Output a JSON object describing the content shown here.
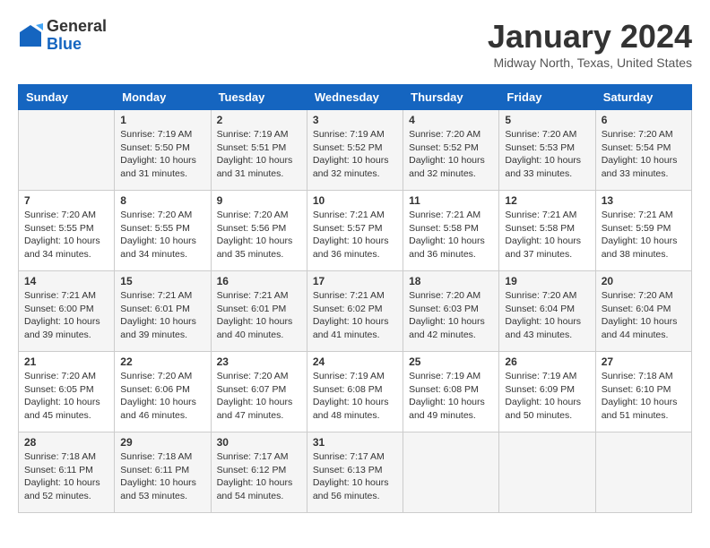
{
  "header": {
    "logo": {
      "line1": "General",
      "line2": "Blue"
    },
    "title": "January 2024",
    "location": "Midway North, Texas, United States"
  },
  "days_of_week": [
    "Sunday",
    "Monday",
    "Tuesday",
    "Wednesday",
    "Thursday",
    "Friday",
    "Saturday"
  ],
  "weeks": [
    [
      {
        "day": "",
        "info": ""
      },
      {
        "day": "1",
        "info": "Sunrise: 7:19 AM\nSunset: 5:50 PM\nDaylight: 10 hours\nand 31 minutes."
      },
      {
        "day": "2",
        "info": "Sunrise: 7:19 AM\nSunset: 5:51 PM\nDaylight: 10 hours\nand 31 minutes."
      },
      {
        "day": "3",
        "info": "Sunrise: 7:19 AM\nSunset: 5:52 PM\nDaylight: 10 hours\nand 32 minutes."
      },
      {
        "day": "4",
        "info": "Sunrise: 7:20 AM\nSunset: 5:52 PM\nDaylight: 10 hours\nand 32 minutes."
      },
      {
        "day": "5",
        "info": "Sunrise: 7:20 AM\nSunset: 5:53 PM\nDaylight: 10 hours\nand 33 minutes."
      },
      {
        "day": "6",
        "info": "Sunrise: 7:20 AM\nSunset: 5:54 PM\nDaylight: 10 hours\nand 33 minutes."
      }
    ],
    [
      {
        "day": "7",
        "info": "Sunrise: 7:20 AM\nSunset: 5:55 PM\nDaylight: 10 hours\nand 34 minutes."
      },
      {
        "day": "8",
        "info": "Sunrise: 7:20 AM\nSunset: 5:55 PM\nDaylight: 10 hours\nand 34 minutes."
      },
      {
        "day": "9",
        "info": "Sunrise: 7:20 AM\nSunset: 5:56 PM\nDaylight: 10 hours\nand 35 minutes."
      },
      {
        "day": "10",
        "info": "Sunrise: 7:21 AM\nSunset: 5:57 PM\nDaylight: 10 hours\nand 36 minutes."
      },
      {
        "day": "11",
        "info": "Sunrise: 7:21 AM\nSunset: 5:58 PM\nDaylight: 10 hours\nand 36 minutes."
      },
      {
        "day": "12",
        "info": "Sunrise: 7:21 AM\nSunset: 5:58 PM\nDaylight: 10 hours\nand 37 minutes."
      },
      {
        "day": "13",
        "info": "Sunrise: 7:21 AM\nSunset: 5:59 PM\nDaylight: 10 hours\nand 38 minutes."
      }
    ],
    [
      {
        "day": "14",
        "info": "Sunrise: 7:21 AM\nSunset: 6:00 PM\nDaylight: 10 hours\nand 39 minutes."
      },
      {
        "day": "15",
        "info": "Sunrise: 7:21 AM\nSunset: 6:01 PM\nDaylight: 10 hours\nand 39 minutes."
      },
      {
        "day": "16",
        "info": "Sunrise: 7:21 AM\nSunset: 6:01 PM\nDaylight: 10 hours\nand 40 minutes."
      },
      {
        "day": "17",
        "info": "Sunrise: 7:21 AM\nSunset: 6:02 PM\nDaylight: 10 hours\nand 41 minutes."
      },
      {
        "day": "18",
        "info": "Sunrise: 7:20 AM\nSunset: 6:03 PM\nDaylight: 10 hours\nand 42 minutes."
      },
      {
        "day": "19",
        "info": "Sunrise: 7:20 AM\nSunset: 6:04 PM\nDaylight: 10 hours\nand 43 minutes."
      },
      {
        "day": "20",
        "info": "Sunrise: 7:20 AM\nSunset: 6:04 PM\nDaylight: 10 hours\nand 44 minutes."
      }
    ],
    [
      {
        "day": "21",
        "info": "Sunrise: 7:20 AM\nSunset: 6:05 PM\nDaylight: 10 hours\nand 45 minutes."
      },
      {
        "day": "22",
        "info": "Sunrise: 7:20 AM\nSunset: 6:06 PM\nDaylight: 10 hours\nand 46 minutes."
      },
      {
        "day": "23",
        "info": "Sunrise: 7:20 AM\nSunset: 6:07 PM\nDaylight: 10 hours\nand 47 minutes."
      },
      {
        "day": "24",
        "info": "Sunrise: 7:19 AM\nSunset: 6:08 PM\nDaylight: 10 hours\nand 48 minutes."
      },
      {
        "day": "25",
        "info": "Sunrise: 7:19 AM\nSunset: 6:08 PM\nDaylight: 10 hours\nand 49 minutes."
      },
      {
        "day": "26",
        "info": "Sunrise: 7:19 AM\nSunset: 6:09 PM\nDaylight: 10 hours\nand 50 minutes."
      },
      {
        "day": "27",
        "info": "Sunrise: 7:18 AM\nSunset: 6:10 PM\nDaylight: 10 hours\nand 51 minutes."
      }
    ],
    [
      {
        "day": "28",
        "info": "Sunrise: 7:18 AM\nSunset: 6:11 PM\nDaylight: 10 hours\nand 52 minutes."
      },
      {
        "day": "29",
        "info": "Sunrise: 7:18 AM\nSunset: 6:11 PM\nDaylight: 10 hours\nand 53 minutes."
      },
      {
        "day": "30",
        "info": "Sunrise: 7:17 AM\nSunset: 6:12 PM\nDaylight: 10 hours\nand 54 minutes."
      },
      {
        "day": "31",
        "info": "Sunrise: 7:17 AM\nSunset: 6:13 PM\nDaylight: 10 hours\nand 56 minutes."
      },
      {
        "day": "",
        "info": ""
      },
      {
        "day": "",
        "info": ""
      },
      {
        "day": "",
        "info": ""
      }
    ]
  ]
}
